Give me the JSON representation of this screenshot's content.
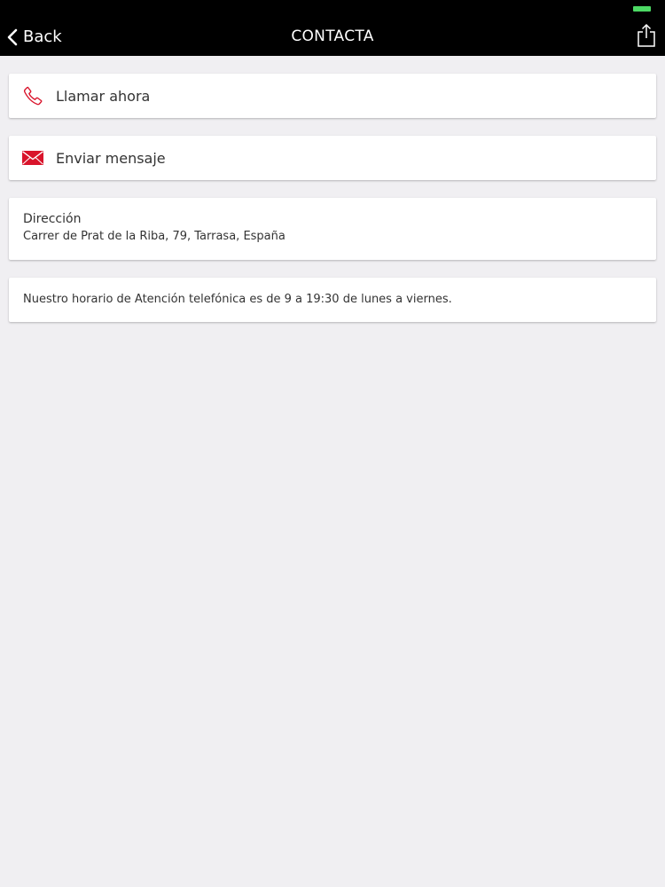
{
  "nav": {
    "back_label": "Back",
    "title": "CONTACTA"
  },
  "icons": {
    "back": "chevron-left-icon",
    "share": "share-icon",
    "phone": "phone-icon",
    "mail": "envelope-icon"
  },
  "colors": {
    "accent": "#d9142b",
    "nav_background": "#000000",
    "page_background": "#f0eff2",
    "battery": "#4cd964"
  },
  "actions": {
    "call_label": "Llamar ahora",
    "message_label": "Enviar mensaje"
  },
  "address": {
    "title": "Dirección",
    "value": "Carrer de Prat de la Riba, 79, Tarrasa, España"
  },
  "hours": {
    "text": "Nuestro horario de Atención telefónica es de 9 a 19:30 de lunes a viernes."
  }
}
